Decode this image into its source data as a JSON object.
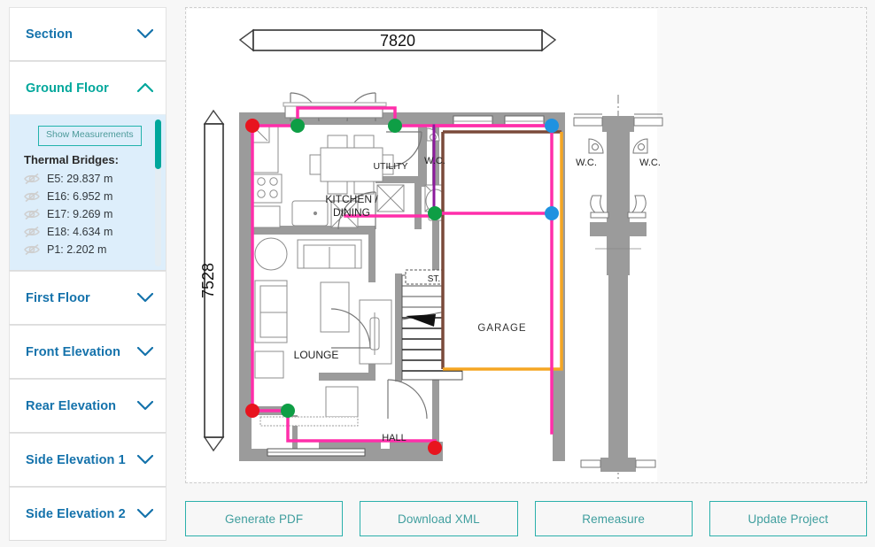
{
  "sidebar": {
    "items": [
      {
        "label": "Section",
        "state": "collapsed",
        "icon": "chevron-down-icon",
        "color": "#1472ab"
      },
      {
        "label": "Ground Floor",
        "state": "expanded",
        "icon": "chevron-up-icon",
        "color": "#00a79b"
      },
      {
        "label": "First Floor",
        "state": "collapsed",
        "icon": "chevron-down-icon",
        "color": "#1472ab"
      },
      {
        "label": "Front Elevation",
        "state": "collapsed",
        "icon": "chevron-down-icon",
        "color": "#1472ab"
      },
      {
        "label": "Rear Elevation",
        "state": "collapsed",
        "icon": "chevron-down-icon",
        "color": "#1472ab"
      },
      {
        "label": "Side Elevation 1",
        "state": "collapsed",
        "icon": "chevron-down-icon",
        "color": "#1472ab"
      },
      {
        "label": "Side Elevation 2",
        "state": "collapsed",
        "icon": "chevron-down-icon",
        "color": "#1472ab"
      }
    ],
    "panel": {
      "show_measurements_label": "Show Measurements",
      "thermal_bridges_heading": "Thermal Bridges:",
      "thermal_bridges": [
        {
          "id": "E5",
          "value": "E5: 29.837 m",
          "icon": "eye-slash-icon"
        },
        {
          "id": "E16",
          "value": "E16: 6.952 m",
          "icon": "eye-slash-icon"
        },
        {
          "id": "E17",
          "value": "E17: 9.269 m",
          "icon": "eye-slash-icon"
        },
        {
          "id": "E18",
          "value": "E18: 4.634 m",
          "icon": "eye-slash-icon"
        },
        {
          "id": "P1",
          "value": "P1: 2.202 m",
          "icon": "eye-slash-icon"
        }
      ]
    }
  },
  "plan": {
    "dimension_top": "7820",
    "dimension_left": "7528",
    "rooms": [
      {
        "name": "kitchen-dining",
        "line1": "KITCHEN /",
        "line2": "DINING"
      },
      {
        "name": "utility",
        "label": "UTILITY"
      },
      {
        "name": "wc-plan",
        "label": "W.C."
      },
      {
        "name": "store",
        "label": "ST."
      },
      {
        "name": "lounge",
        "label": "LOUNGE"
      },
      {
        "name": "hall",
        "label": "HALL"
      },
      {
        "name": "garage",
        "label": "GARAGE"
      }
    ],
    "section_detail": {
      "wc_left": "W.C.",
      "wc_right": "W.C."
    },
    "colors": {
      "junction_red": "#e8141e",
      "junction_green": "#0e9e45",
      "junction_blue": "#1f92e0",
      "line_pink": "#ff2eaa",
      "line_purple": "#8c1a9c",
      "line_orange": "#f5a623",
      "line_brown": "#7a4a3a",
      "wall_fill": "#9b9b9b"
    }
  },
  "footer": {
    "buttons": [
      {
        "label": "Generate PDF"
      },
      {
        "label": "Download XML"
      },
      {
        "label": "Remeasure"
      },
      {
        "label": "Update Project"
      }
    ]
  }
}
